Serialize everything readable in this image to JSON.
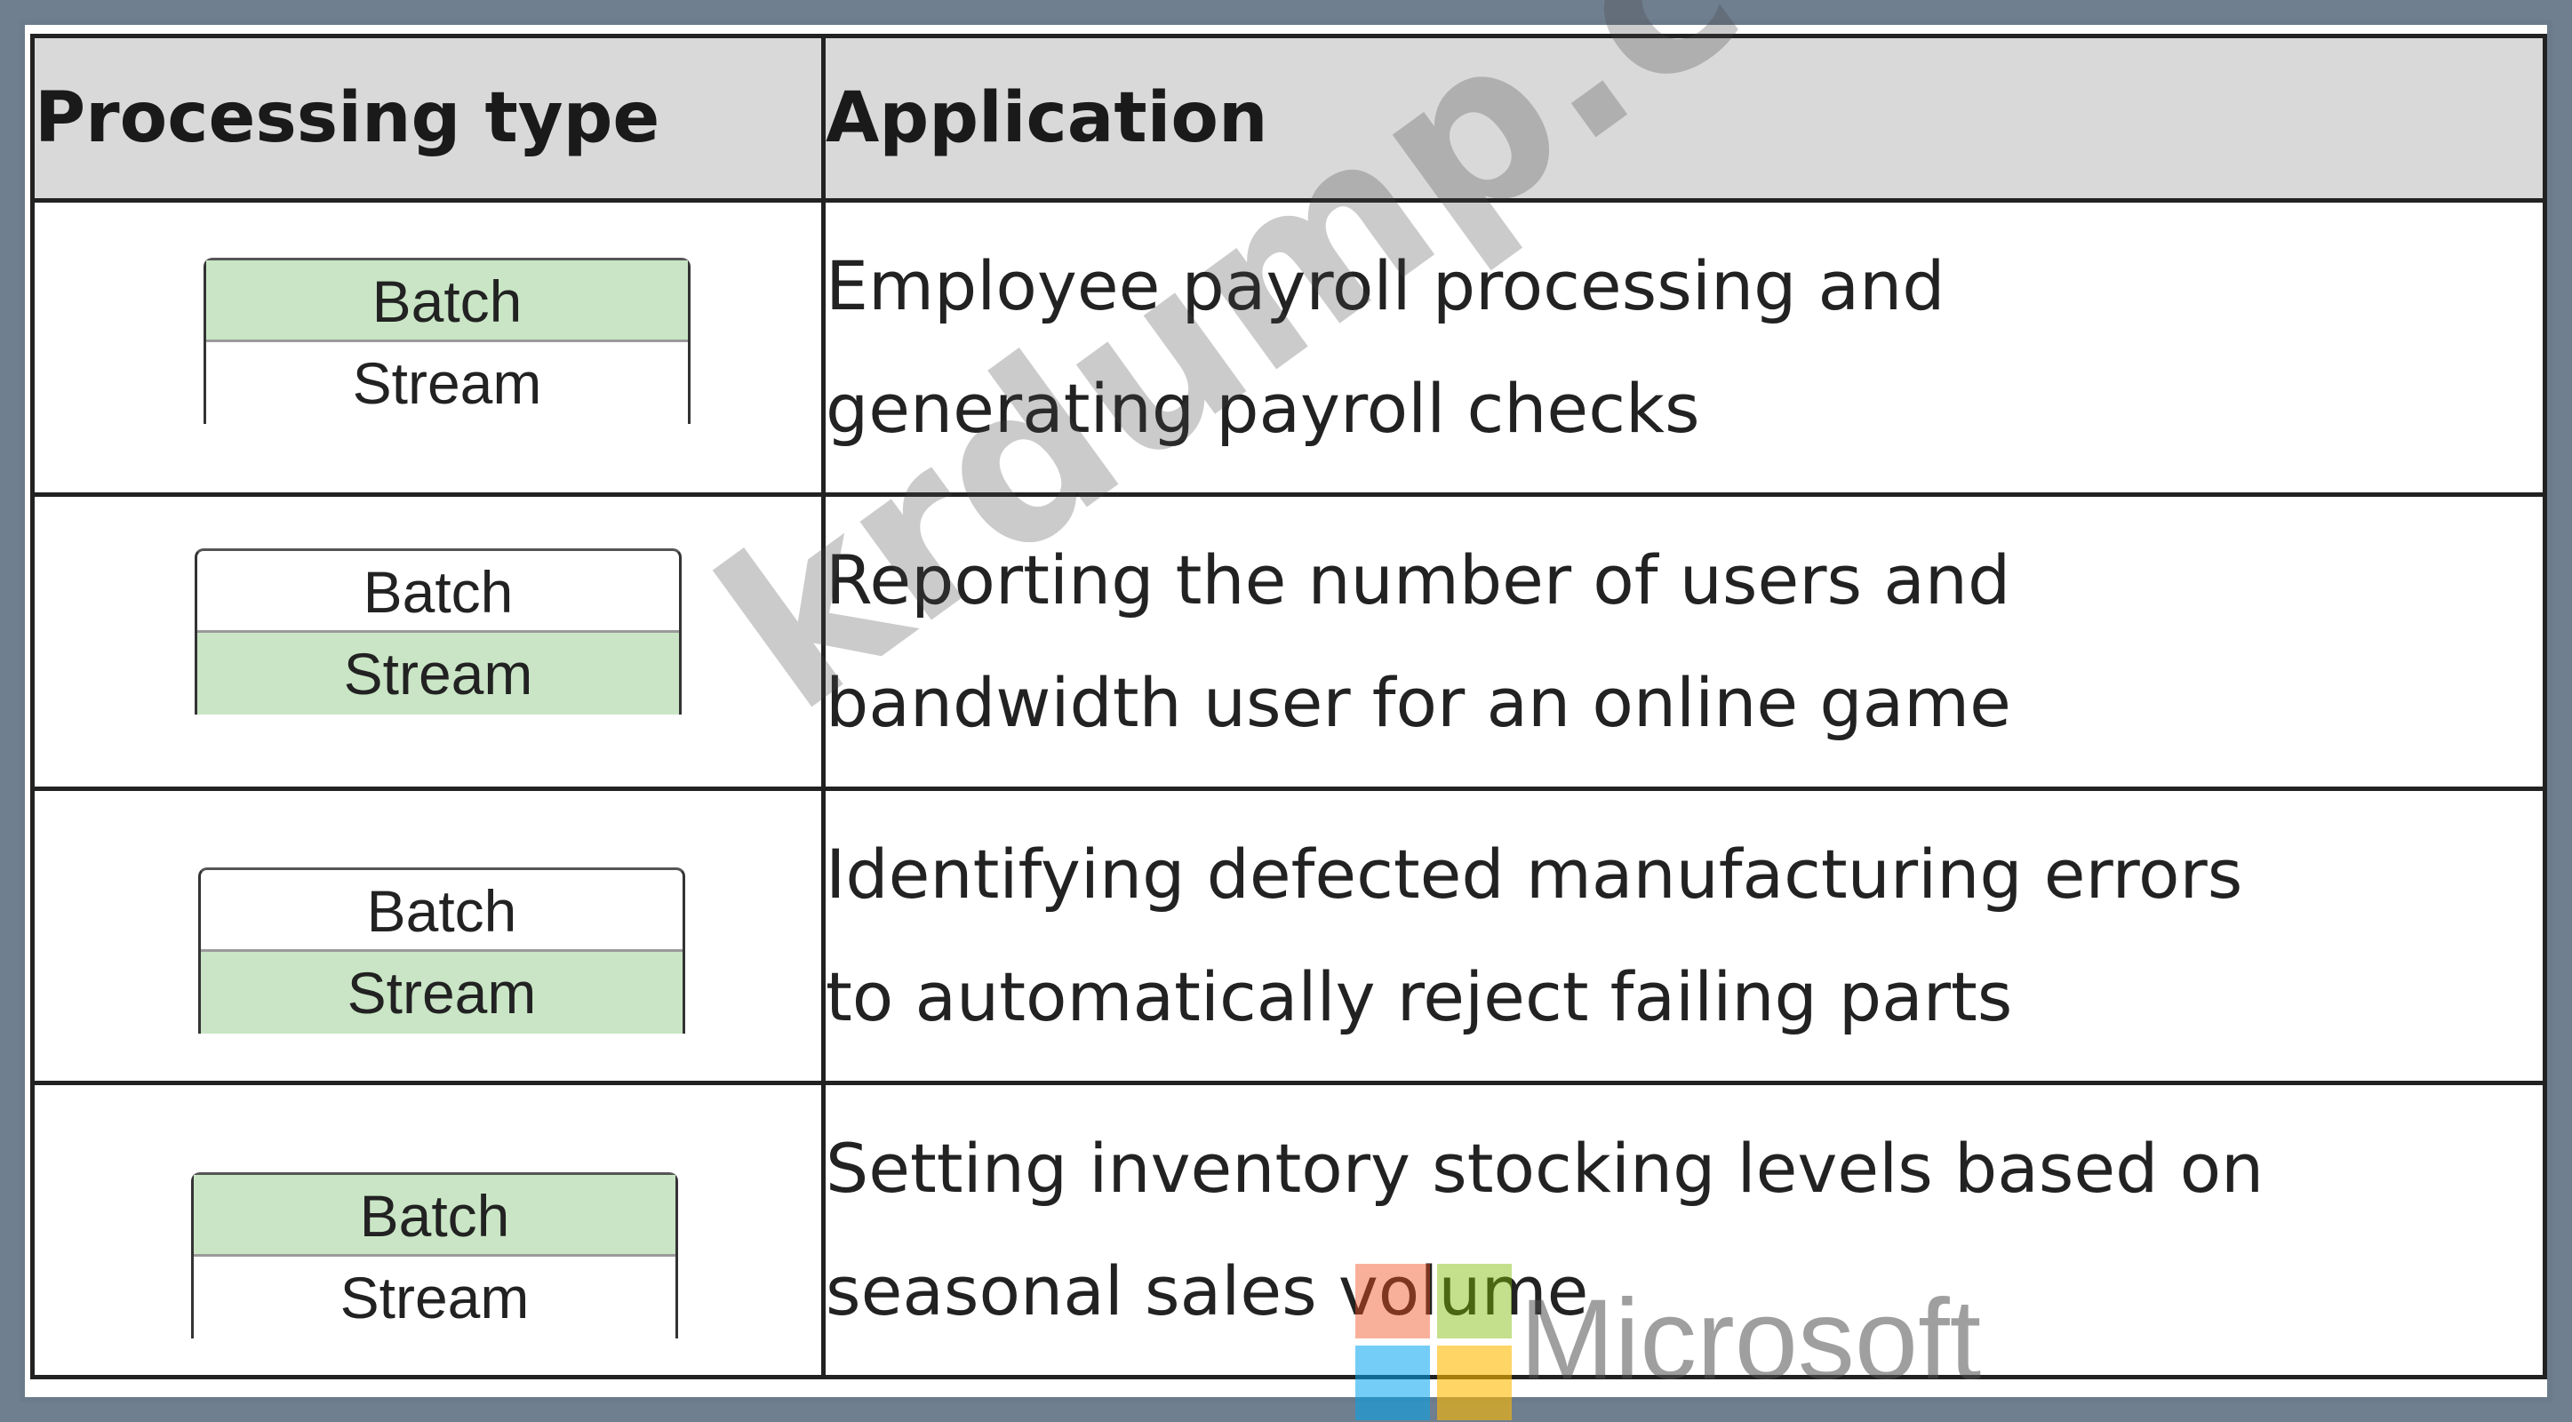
{
  "table": {
    "headers": {
      "processing_type": "Processing type",
      "application": "Application"
    },
    "rows": [
      {
        "options": [
          "Batch",
          "Stream"
        ],
        "selected": "Batch",
        "application_lines": [
          "Employee payroll processing and",
          "generating payroll checks"
        ]
      },
      {
        "options": [
          "Batch",
          "Stream"
        ],
        "selected": "Stream",
        "application_lines": [
          "Reporting the number of users and",
          "bandwidth user for an online game"
        ]
      },
      {
        "options": [
          "Batch",
          "Stream"
        ],
        "selected": "Stream",
        "application_lines": [
          "Identifying defected manufacturing errors",
          "to automatically reject failing parts"
        ]
      },
      {
        "options": [
          "Batch",
          "Stream"
        ],
        "selected": "Batch",
        "application_lines": [
          "Setting inventory stocking levels based on",
          "seasonal sales volume"
        ]
      }
    ]
  },
  "watermark": "krdump.com",
  "logo": {
    "name": "microsoft-logo",
    "text": "Microsoft"
  },
  "colors": {
    "selected_option": "#c9e5c5",
    "header_background": "#d9d9d9",
    "frame": "#6b7b8b"
  }
}
